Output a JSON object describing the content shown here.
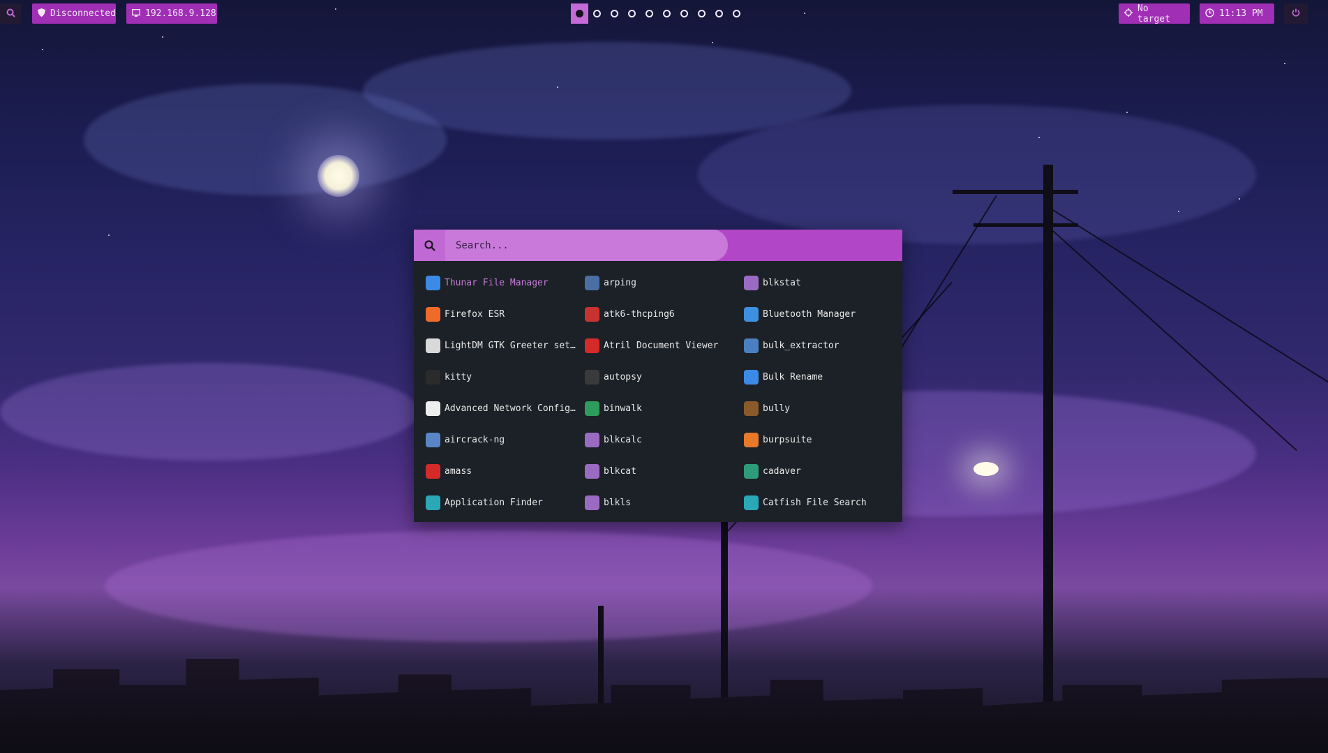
{
  "topbar": {
    "vpn_status": "Disconnected",
    "ip_address": "192.168.9.128",
    "target": "No target",
    "time": "11:13 PM",
    "workspaces": [
      1,
      2,
      3,
      4,
      5,
      6,
      7,
      8,
      9,
      10
    ],
    "active_workspace": 1
  },
  "launcher": {
    "search_placeholder": "Search...",
    "columns": [
      [
        {
          "label": "Thunar File Manager",
          "icon": "folder-icon",
          "color": "#3b8be6"
        },
        {
          "label": "Firefox ESR",
          "icon": "firefox-icon",
          "color": "#f06b2b"
        },
        {
          "label": "LightDM GTK Greeter sett…",
          "icon": "lightdm-icon",
          "color": "#d9d9d9"
        },
        {
          "label": "kitty",
          "icon": "terminal-icon",
          "color": "#2b2b2b"
        },
        {
          "label": "Advanced Network Configu…",
          "icon": "network-icon",
          "color": "#eeeeee"
        },
        {
          "label": "aircrack-ng",
          "icon": "aircrack-icon",
          "color": "#5a86c8"
        },
        {
          "label": "amass",
          "icon": "amass-icon",
          "color": "#d42a2a"
        },
        {
          "label": "Application Finder",
          "icon": "search-app-icon",
          "color": "#2aa8b8"
        }
      ],
      [
        {
          "label": "arping",
          "icon": "arping-icon",
          "color": "#4a6fa5"
        },
        {
          "label": "atk6-thcping6",
          "icon": "ipv6-icon",
          "color": "#c8322f"
        },
        {
          "label": "Atril Document Viewer",
          "icon": "pdf-icon",
          "color": "#d42a2a"
        },
        {
          "label": "autopsy",
          "icon": "autopsy-icon",
          "color": "#3a3a3a"
        },
        {
          "label": "binwalk",
          "icon": "binwalk-icon",
          "color": "#2e9c5a"
        },
        {
          "label": "blkcalc",
          "icon": "cube-icon",
          "color": "#9b6bc4"
        },
        {
          "label": "blkcat",
          "icon": "cube-search-icon",
          "color": "#9b6bc4"
        },
        {
          "label": "blkls",
          "icon": "cube-icon",
          "color": "#9b6bc4"
        }
      ],
      [
        {
          "label": "blkstat",
          "icon": "cube-info-icon",
          "color": "#9b6bc4"
        },
        {
          "label": "Bluetooth Manager",
          "icon": "bluetooth-icon",
          "color": "#3d8fe0"
        },
        {
          "label": "bulk_extractor",
          "icon": "bulk-extractor-icon",
          "color": "#4a7fc0"
        },
        {
          "label": "Bulk Rename",
          "icon": "folder-icon",
          "color": "#3b8be6"
        },
        {
          "label": "bully",
          "icon": "bully-icon",
          "color": "#8a5a2a"
        },
        {
          "label": "burpsuite",
          "icon": "burpsuite-icon",
          "color": "#e8782a"
        },
        {
          "label": "cadaver",
          "icon": "cadaver-icon",
          "color": "#2e9c7a"
        },
        {
          "label": "Catfish File Search",
          "icon": "search-app-icon",
          "color": "#2aa8b8"
        }
      ]
    ],
    "selected": "Thunar File Manager"
  }
}
